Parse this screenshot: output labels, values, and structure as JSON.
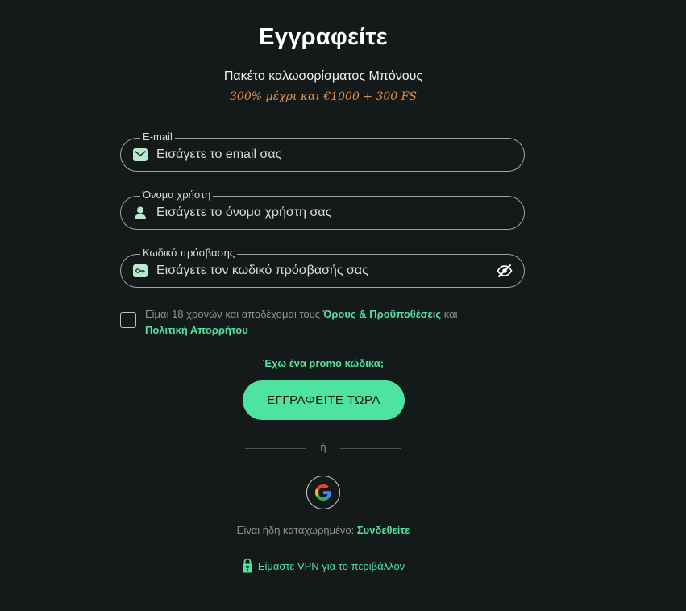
{
  "page": {
    "title": "Εγγραφείτε",
    "subtitle": "Πακέτο καλωσορίσματος Μπόνους",
    "bonus": "300% μέχρι και €1000 + 300 FS"
  },
  "form": {
    "email": {
      "label": "E-mail",
      "placeholder": "Εισάγετε το email σας",
      "icon": "mail-icon"
    },
    "username": {
      "label": "Όνομα χρήστη",
      "placeholder": "Εισάγετε το όνομα χρήστη σας",
      "icon": "user-icon"
    },
    "password": {
      "label": "Κωδικό πρόσβασης",
      "placeholder": "Εισάγετε τον κωδικό πρόσβασής σας",
      "icon": "key-icon",
      "toggle_icon": "eye-off-icon"
    }
  },
  "terms": {
    "prefix": "Είμαι 18 χρονών και αποδέχομαι τους ",
    "terms_link": "Όρους & Προϋποθέσεις",
    "middle": " και ",
    "privacy_link": "Πολιτική Απορρήτου"
  },
  "promo_link": "Έχω ένα promo κώδικα;",
  "submit_label": "ΕΓΓΡΑΦΕΙΤΕ ΤΩΡΑ",
  "divider_text": "ή",
  "social": {
    "google_icon": "google-icon"
  },
  "login": {
    "prompt": "Είναι ήδη καταχωρημένο: ",
    "link": "Συνδεθείτε"
  },
  "vpn": {
    "text": "Είμαστε VPN για το περιβάλλον",
    "icon": "vpn-lock-icon"
  },
  "colors": {
    "background": "#141a19",
    "accent": "#4ee3a0",
    "bonus": "#e8904a",
    "border": "#9aa8a2"
  }
}
